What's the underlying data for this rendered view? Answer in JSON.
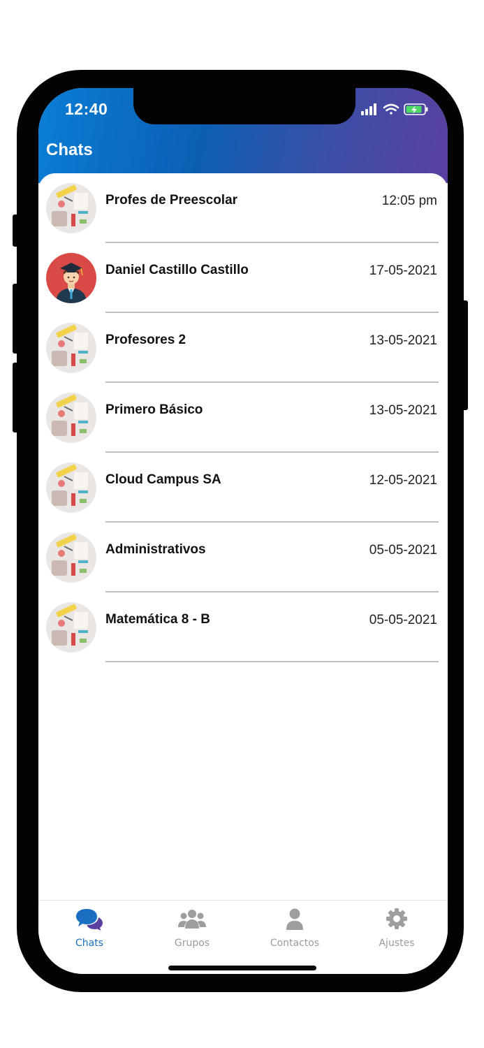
{
  "status_bar": {
    "time": "12:40"
  },
  "header": {
    "title": "Chats"
  },
  "chats": [
    {
      "name": "Profes de Preescolar",
      "date": "12:05 pm",
      "avatar": "stationery-group-avatar"
    },
    {
      "name": "Daniel Castillo Castillo",
      "date": "17-05-2021",
      "avatar": "graduate-person-avatar"
    },
    {
      "name": "Profesores 2",
      "date": "13-05-2021",
      "avatar": "stationery-group-avatar"
    },
    {
      "name": "Primero Básico",
      "date": "13-05-2021",
      "avatar": "stationery-group-avatar"
    },
    {
      "name": "Cloud Campus SA",
      "date": "12-05-2021",
      "avatar": "stationery-group-avatar"
    },
    {
      "name": "Administrativos",
      "date": "05-05-2021",
      "avatar": "stationery-group-avatar"
    },
    {
      "name": "Matemática 8 - B",
      "date": "05-05-2021",
      "avatar": "stationery-group-avatar"
    }
  ],
  "tabs": [
    {
      "label": "Chats",
      "icon": "chat-bubbles-icon",
      "active": true
    },
    {
      "label": "Grupos",
      "icon": "group-icon",
      "active": false
    },
    {
      "label": "Contactos",
      "icon": "person-icon",
      "active": false
    },
    {
      "label": "Ajustes",
      "icon": "gear-icon",
      "active": false
    }
  ],
  "colors": {
    "header_gradient_start": "#0a7ed6",
    "header_gradient_end": "#5a3fa0",
    "active_tab": "#1a6fc2",
    "inactive_tab": "#9a9a9a"
  }
}
